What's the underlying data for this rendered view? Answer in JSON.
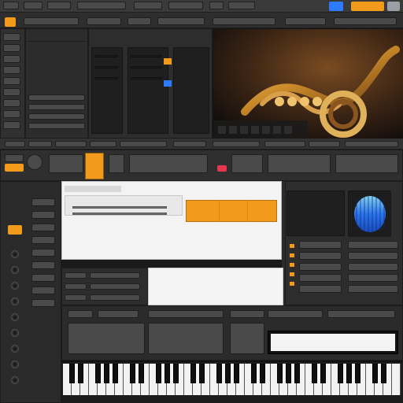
{
  "topbar": {
    "segment_labels": [],
    "right_badges": [
      {
        "text": "",
        "color": "#2d7cff"
      },
      {
        "text": "",
        "color": "#f19a1b"
      }
    ]
  },
  "browser": {
    "title": "",
    "tabs": [],
    "left_items": []
  },
  "image_preview": {
    "caption": ""
  },
  "mid_toolbar": {
    "labels": []
  },
  "device": {
    "title": "",
    "right_title": "",
    "slider_rows": [],
    "orange_tiles": [],
    "pads": []
  },
  "mixer": {
    "left_column_labels": [],
    "right_column_labels": []
  },
  "keyboard": {
    "label": ""
  },
  "colors": {
    "accent_orange": "#f19a1b",
    "accent_red": "#e7374f",
    "accent_blue": "#2d7cff",
    "panel_dark": "#2b2b2b"
  },
  "icons": {
    "waveform": "waveform-icon"
  }
}
